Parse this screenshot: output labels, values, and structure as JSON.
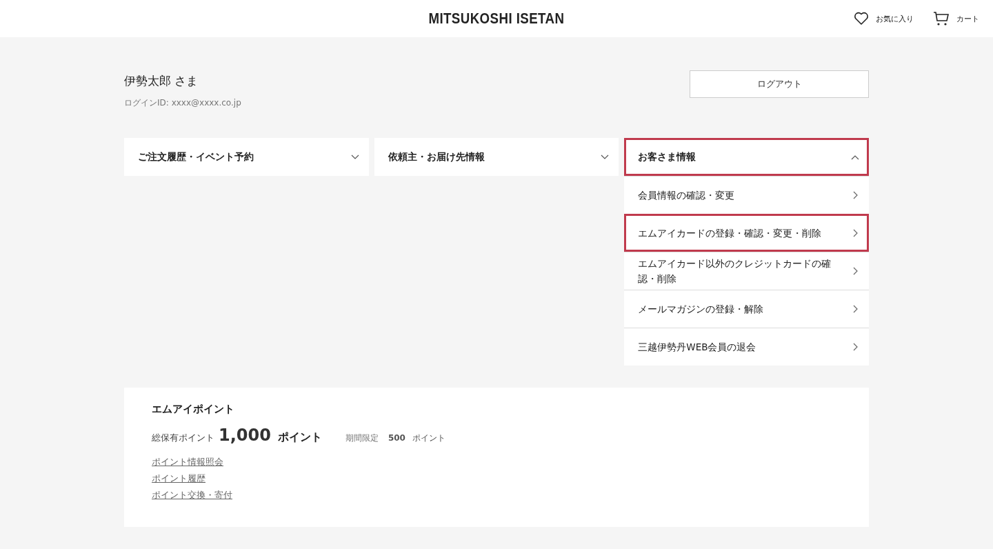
{
  "header": {
    "logo": "MITSUKOSHI ISETAN",
    "favorites": "お気に入り",
    "cart": "カート"
  },
  "user": {
    "name": "伊勢太郎 さま",
    "login_id": "ログインID: xxxx@xxxx.co.jp",
    "logout": "ログアウト"
  },
  "menus": [
    {
      "label": "ご注文履歴・イベント予約",
      "expanded": false,
      "highlighted": false
    },
    {
      "label": "依頼主・お届け先情報",
      "expanded": false,
      "highlighted": false
    },
    {
      "label": "お客さま情報",
      "expanded": true,
      "highlighted": true,
      "items": [
        {
          "label": "会員情報の確認・変更",
          "highlighted": false
        },
        {
          "label": "エムアイカードの登録・確認・変更・削除",
          "highlighted": true
        },
        {
          "label": "エムアイカード以外のクレジットカードの確認・削除",
          "highlighted": false
        },
        {
          "label": "メールマガジンの登録・解除",
          "highlighted": false
        },
        {
          "label": "三越伊勢丹WEB会員の退会",
          "highlighted": false
        }
      ]
    }
  ],
  "points": {
    "title": "エムアイポイント",
    "total_label": "総保有ポイント",
    "total": "1,000",
    "unit": "ポイント",
    "limited_label": "期間限定",
    "limited": "500",
    "limited_unit": "ポイント",
    "links": [
      "ポイント情報照会",
      "ポイント履歴",
      "ポイント交換・寄付"
    ]
  }
}
